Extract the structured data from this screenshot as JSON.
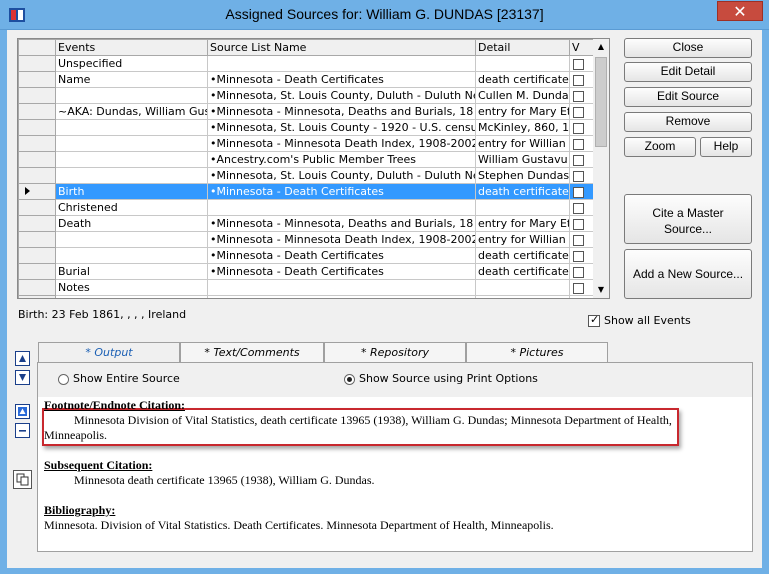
{
  "window": {
    "title": "Assigned Sources for: William G. DUNDAS [23137]",
    "close_symbol": "✕"
  },
  "grid": {
    "headers": [
      "Events",
      "Source List Name",
      "Detail",
      "V"
    ],
    "rows": [
      {
        "event": "Unspecified",
        "source": "",
        "detail": "",
        "selected": false,
        "current": false
      },
      {
        "event": "Name",
        "source": "•Minnesota - Death Certificates",
        "detail": "death certificate,",
        "selected": false,
        "current": false
      },
      {
        "event": "",
        "source": "•Minnesota, St. Louis County, Duluth - Duluth Ne",
        "detail": "Cullen M. Dunda",
        "selected": false,
        "current": false
      },
      {
        "event": "~AKA: Dundas, William Gus",
        "source": "•Minnesota - Minnesota, Deaths and Burials, 18",
        "detail": "entry for Mary Et",
        "selected": false,
        "current": false
      },
      {
        "event": "",
        "source": "•Minnesota, St. Louis County - 1920 - U.S. census",
        "detail": "McKinley, 860, 17",
        "selected": false,
        "current": false
      },
      {
        "event": "",
        "source": "•Minnesota - Minnesota Death Index, 1908-2002",
        "detail": "entry for Willian",
        "selected": false,
        "current": false
      },
      {
        "event": "",
        "source": "•Ancestry.com's Public Member Trees",
        "detail": "William Gustavu",
        "selected": false,
        "current": false
      },
      {
        "event": "",
        "source": "•Minnesota, St. Louis County, Duluth - Duluth Ne",
        "detail": "Stephen Dundas",
        "selected": false,
        "current": false
      },
      {
        "event": "Birth",
        "source": "•Minnesota - Death Certificates",
        "detail": "death certificate",
        "selected": true,
        "current": true
      },
      {
        "event": "Christened",
        "source": "",
        "detail": "",
        "selected": false,
        "current": false
      },
      {
        "event": "Death",
        "source": "•Minnesota - Minnesota, Deaths and Burials, 18",
        "detail": "entry for Mary Et",
        "selected": false,
        "current": false
      },
      {
        "event": "",
        "source": "•Minnesota - Minnesota Death Index, 1908-2002",
        "detail": "entry for Willian",
        "selected": false,
        "current": false
      },
      {
        "event": "",
        "source": "•Minnesota - Death Certificates",
        "detail": "death certificate,",
        "selected": false,
        "current": false
      },
      {
        "event": "Burial",
        "source": "•Minnesota - Death Certificates",
        "detail": "death certificate,",
        "selected": false,
        "current": false
      },
      {
        "event": "Notes",
        "source": "",
        "detail": "",
        "selected": false,
        "current": false
      },
      {
        "event": "",
        "source": "",
        "detail": "",
        "selected": false,
        "current": false
      }
    ]
  },
  "buttons": {
    "close": "Close",
    "edit_detail": "Edit Detail",
    "edit_source": "Edit Source",
    "remove": "Remove",
    "zoom": "Zoom",
    "help": "Help",
    "cite_master": "Cite a Master Source...",
    "add_new_source": "Add a New Source..."
  },
  "status": {
    "birth_line": "Birth: 23 Feb 1861, , , , Ireland",
    "show_all_events": "Show all Events"
  },
  "tabs": [
    "* Output",
    "* Text/Comments",
    "* Repository",
    "* Pictures"
  ],
  "output": {
    "radio_entire": "Show Entire Source",
    "radio_print": "Show Source using Print Options",
    "footnote_header": "Footnote/Endnote Citation:",
    "footnote_line1": "Minnesota Division of Vital Statistics, death certificate 13965 (1938), William G. Dundas; Minnesota Department of Health,",
    "footnote_line2": "Minneapolis.",
    "subsequent_header": "Subsequent Citation:",
    "subsequent_text": "Minnesota death certificate 13965 (1938), William G. Dundas.",
    "bibliography_header": "Bibliography:",
    "bibliography_text": "Minnesota. Division of Vital Statistics. Death Certificates. Minnesota Department of Health, Minneapolis."
  },
  "colors": {
    "title_bar": "#6fb0e6",
    "selection": "#3399ff",
    "highlight_box": "#c8282e"
  }
}
